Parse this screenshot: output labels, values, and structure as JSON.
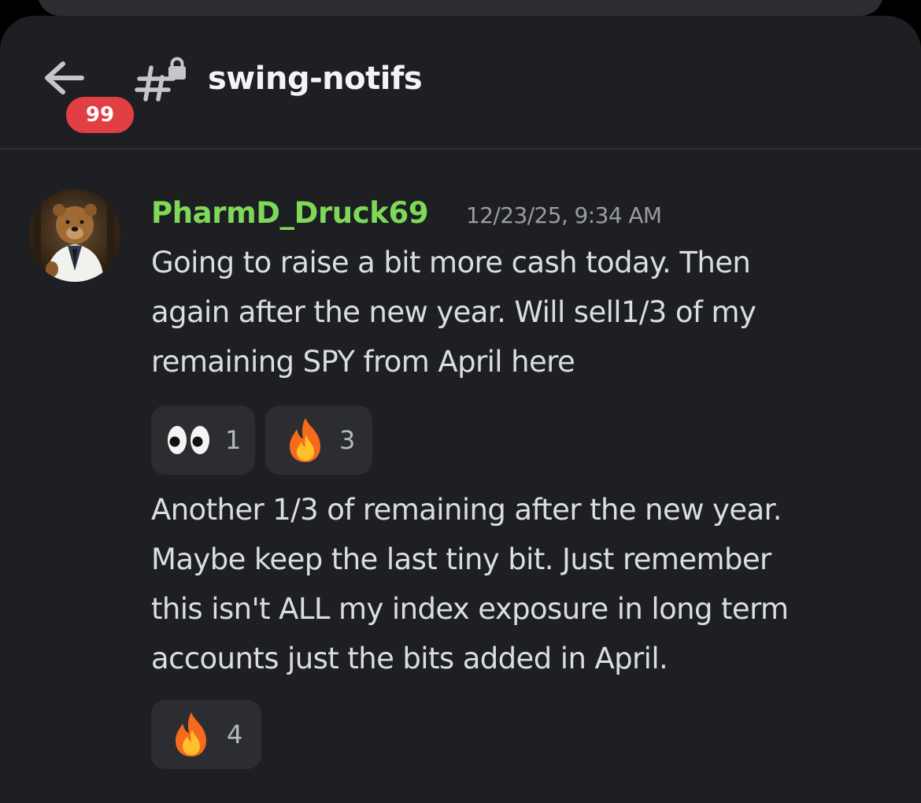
{
  "header": {
    "back_label": "Back",
    "unread_badge": "99",
    "channel_name": "swing-notifs",
    "channel_icon": "locked-text-channel-icon"
  },
  "message": {
    "author": "PharmD_Druck69",
    "author_color": "#7dd957",
    "timestamp": "12/23/25, 9:34 AM",
    "avatar_icon": "bear-in-lab-coat-avatar",
    "first": {
      "lines": [
        "Going to raise a bit more cash today. Then",
        "again after the new year. Will sell1/3 of my",
        "remaining SPY from April here"
      ],
      "reactions": [
        {
          "emoji_icon": "eyes-emoji",
          "count": "1"
        },
        {
          "emoji_icon": "fire-emoji",
          "count": "3"
        }
      ]
    },
    "second": {
      "lines": [
        "Another 1/3 of remaining after the new year.",
        "Maybe keep the last tiny bit. Just remember",
        "this isn't ALL my index exposure in long term",
        "accounts just the bits added in April."
      ],
      "reactions": [
        {
          "emoji_icon": "fire-emoji",
          "count": "4"
        }
      ]
    }
  },
  "colors": {
    "background": "#1e1f23",
    "text": "#dbdee1",
    "badge": "#e23f44",
    "reaction_bg": "#2b2d31"
  }
}
